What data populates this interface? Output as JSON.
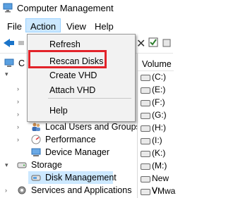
{
  "window": {
    "title": "Computer Management"
  },
  "menubar": {
    "items": [
      "File",
      "Action",
      "View",
      "Help"
    ],
    "open": "Action"
  },
  "dropdown": {
    "items": [
      "Refresh",
      "Rescan Disks",
      "Create VHD",
      "Attach VHD",
      "Help"
    ],
    "highlighted": "Rescan Disks",
    "highlight_color": "#e2232a"
  },
  "tree": {
    "partial_label": "C",
    "items": [
      "Local Users and Groups",
      "Performance",
      "Device Manager",
      "Storage",
      "Disk Management",
      "Services and Applications"
    ]
  },
  "volumes": {
    "header": "Volume",
    "rows": [
      "(C:)",
      "(E:)",
      "(F:)",
      "(G:)",
      "(H:)",
      "(I:)",
      "(K:)",
      "(M:)",
      "New V",
      "VMwa"
    ]
  },
  "colors": {
    "accent": "#1b74c9",
    "menu_open_bg": "#cce8ff",
    "selection_bg": "#cce8ff"
  }
}
